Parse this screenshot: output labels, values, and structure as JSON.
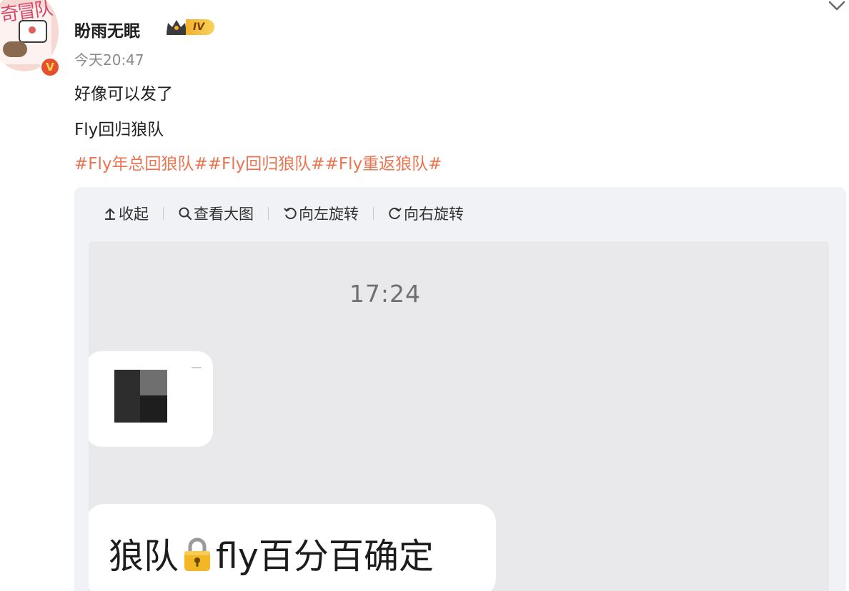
{
  "post": {
    "username": "盼雨无眠",
    "level_badge": "IV",
    "verified_badge": "V",
    "avatar_text": "奇冒队",
    "timestamp": "今天20:47",
    "lines": [
      "好像可以发了",
      "Fly回归狼队"
    ],
    "hashtags": [
      "#Fly年总回狼队#",
      "#Fly回归狼队#",
      "#Fly重返狼队#"
    ],
    "hashtag_color": "#eb7350",
    "expand_icon": "chevron-down-icon"
  },
  "image_toolbar": {
    "items": [
      {
        "icon": "collapse-up-icon",
        "label": "收起"
      },
      {
        "icon": "search-icon",
        "label": "查看大图"
      },
      {
        "icon": "rotate-left-icon",
        "label": "向左旋转"
      },
      {
        "icon": "rotate-right-icon",
        "label": "向右旋转"
      }
    ]
  },
  "screenshot": {
    "chat_time": "17:24",
    "message_text_before": "狼队",
    "message_icon": "lock-icon",
    "message_text_after": "fly百分百确定"
  }
}
